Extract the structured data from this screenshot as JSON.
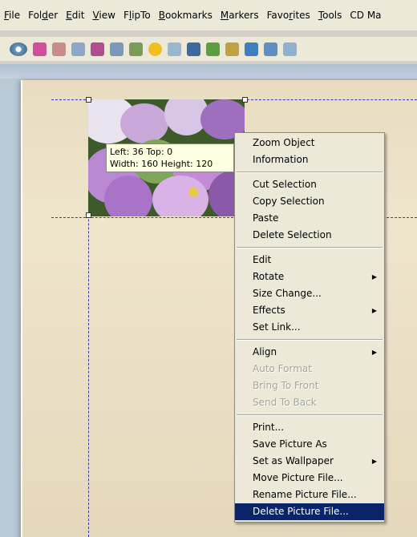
{
  "menubar": {
    "items": [
      {
        "pre": "",
        "u": "F",
        "post": "ile"
      },
      {
        "pre": "Fol",
        "u": "d",
        "post": "er"
      },
      {
        "pre": "",
        "u": "E",
        "post": "dit"
      },
      {
        "pre": "",
        "u": "V",
        "post": "iew"
      },
      {
        "pre": "F",
        "u": "l",
        "post": "ipTo"
      },
      {
        "pre": "",
        "u": "B",
        "post": "ookmarks"
      },
      {
        "pre": "",
        "u": "M",
        "post": "arkers"
      },
      {
        "pre": "Favo",
        "u": "r",
        "post": "ites"
      },
      {
        "pre": "",
        "u": "T",
        "post": "ools"
      },
      {
        "pre": "CD Ma",
        "u": "",
        "post": ""
      }
    ]
  },
  "toolbar": {
    "icons": [
      "eye-icon",
      "pink-page-icon",
      "book-icon",
      "page-icon",
      "export-icon",
      "columns-icon",
      "doc-icon",
      "add-icon",
      "pen-icon",
      "split-icon",
      "tag-icon",
      "image-icon",
      "play-icon",
      "frame-icon",
      "extra-icon"
    ]
  },
  "tooltip": {
    "line1": "Left: 36 Top: 0",
    "line2": "Width: 160 Height: 120"
  },
  "context_menu": {
    "groups": [
      [
        {
          "label": "Zoom Object"
        },
        {
          "label": "Information"
        }
      ],
      [
        {
          "label": "Cut Selection"
        },
        {
          "label": "Copy Selection"
        },
        {
          "label": "Paste"
        },
        {
          "label": "Delete Selection"
        }
      ],
      [
        {
          "label": "Edit"
        },
        {
          "label": "Rotate",
          "submenu": true
        },
        {
          "label": "Size Change..."
        },
        {
          "label": "Effects",
          "submenu": true
        },
        {
          "label": "Set Link..."
        }
      ],
      [
        {
          "label": "Align",
          "submenu": true
        },
        {
          "label": "Auto Format",
          "disabled": true
        },
        {
          "label": "Bring To Front",
          "disabled": true
        },
        {
          "label": "Send To Back",
          "disabled": true
        }
      ],
      [
        {
          "label": "Print..."
        },
        {
          "label": "Save Picture As"
        },
        {
          "label": "Set as Wallpaper",
          "submenu": true
        },
        {
          "label": "Move Picture File..."
        },
        {
          "label": "Rename Picture File..."
        },
        {
          "label": "Delete Picture File...",
          "selected": true
        }
      ]
    ]
  },
  "colors": {
    "selection": "#0a246a",
    "guide": "#3b3bb0",
    "tooltip_bg": "#ffffe1"
  }
}
